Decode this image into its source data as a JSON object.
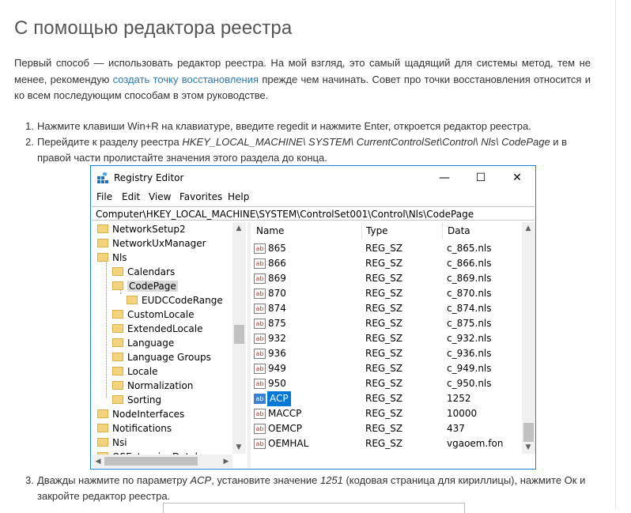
{
  "article": {
    "title": "С помощью редактора реестра",
    "intro_before": "Первый способ — использовать редактор реестра. На мой взгляд, это самый щадящий для системы метод, тем не менее, рекомендую",
    "intro_link": "создать точку восстановления",
    "intro_after": "прежде чем начинать. Совет про точки восстановления относится и ко всем последующим способам в этом руководстве.",
    "step1": {
      "num": "1.",
      "text": "Нажмите клавиши Win+R на клавиатуре, введите regedit и нажмите Enter, откроется редактор реестра."
    },
    "step2": {
      "num": "2.",
      "before": "Перейдите к разделу реестра ",
      "path": "HKEY_LOCAL_MACHINE\\ SYSTEM\\ CurrentControlSet\\Control\\ Nls\\ CodePage",
      "after": " и в правой части пролистайте значения этого раздела до конца."
    },
    "step3": {
      "num": "3.",
      "before": "Дважды нажмите по параметру ",
      "param": "ACP",
      "middle": ", установите значение ",
      "value": "1251",
      "after": " (кодовая страница для кириллицы), нажмите Ок и закройте редактор реестра."
    }
  },
  "window": {
    "title": "Registry Editor",
    "controls": {
      "minimize": "—",
      "maximize": "☐",
      "close": "✕"
    },
    "menu": [
      "File",
      "Edit",
      "View",
      "Favorites",
      "Help"
    ],
    "address": "Computer\\HKEY_LOCAL_MACHINE\\SYSTEM\\ControlSet001\\Control\\Nls\\CodePage",
    "tree": [
      {
        "label": "NetworkSetup2",
        "level": 0
      },
      {
        "label": "NetworkUxManager",
        "level": 0
      },
      {
        "label": "Nls",
        "level": 0
      },
      {
        "label": "Calendars",
        "level": 1
      },
      {
        "label": "CodePage",
        "level": 1,
        "selected": true
      },
      {
        "label": "EUDCCodeRange",
        "level": 2
      },
      {
        "label": "CustomLocale",
        "level": 1
      },
      {
        "label": "ExtendedLocale",
        "level": 1
      },
      {
        "label": "Language",
        "level": 1
      },
      {
        "label": "Language Groups",
        "level": 1
      },
      {
        "label": "Locale",
        "level": 1
      },
      {
        "label": "Normalization",
        "level": 1
      },
      {
        "label": "Sorting",
        "level": 1
      },
      {
        "label": "NodeInterfaces",
        "level": 0
      },
      {
        "label": "Notifications",
        "level": 0
      },
      {
        "label": "Nsi",
        "level": 0
      },
      {
        "label": "OSExtensionDatab",
        "level": 0
      }
    ],
    "columns": {
      "name": "Name",
      "type": "Type",
      "data": "Data"
    },
    "icon_text": "ab",
    "values": [
      {
        "name": "865",
        "type": "REG_SZ",
        "data": "c_865.nls"
      },
      {
        "name": "866",
        "type": "REG_SZ",
        "data": "c_866.nls"
      },
      {
        "name": "869",
        "type": "REG_SZ",
        "data": "c_869.nls"
      },
      {
        "name": "870",
        "type": "REG_SZ",
        "data": "c_870.nls"
      },
      {
        "name": "874",
        "type": "REG_SZ",
        "data": "c_874.nls"
      },
      {
        "name": "875",
        "type": "REG_SZ",
        "data": "c_875.nls"
      },
      {
        "name": "932",
        "type": "REG_SZ",
        "data": "c_932.nls"
      },
      {
        "name": "936",
        "type": "REG_SZ",
        "data": "c_936.nls"
      },
      {
        "name": "949",
        "type": "REG_SZ",
        "data": "c_949.nls"
      },
      {
        "name": "950",
        "type": "REG_SZ",
        "data": "c_950.nls"
      },
      {
        "name": "ACP",
        "type": "REG_SZ",
        "data": "1252",
        "selected": true
      },
      {
        "name": "MACCP",
        "type": "REG_SZ",
        "data": "10000"
      },
      {
        "name": "OEMCP",
        "type": "REG_SZ",
        "data": "437"
      },
      {
        "name": "OEMHAL",
        "type": "REG_SZ",
        "data": "vgaoem.fon"
      }
    ],
    "colors": {
      "accent_border": "#1883d7",
      "selection": "#0078d7",
      "link": "#2a7ab0"
    }
  }
}
